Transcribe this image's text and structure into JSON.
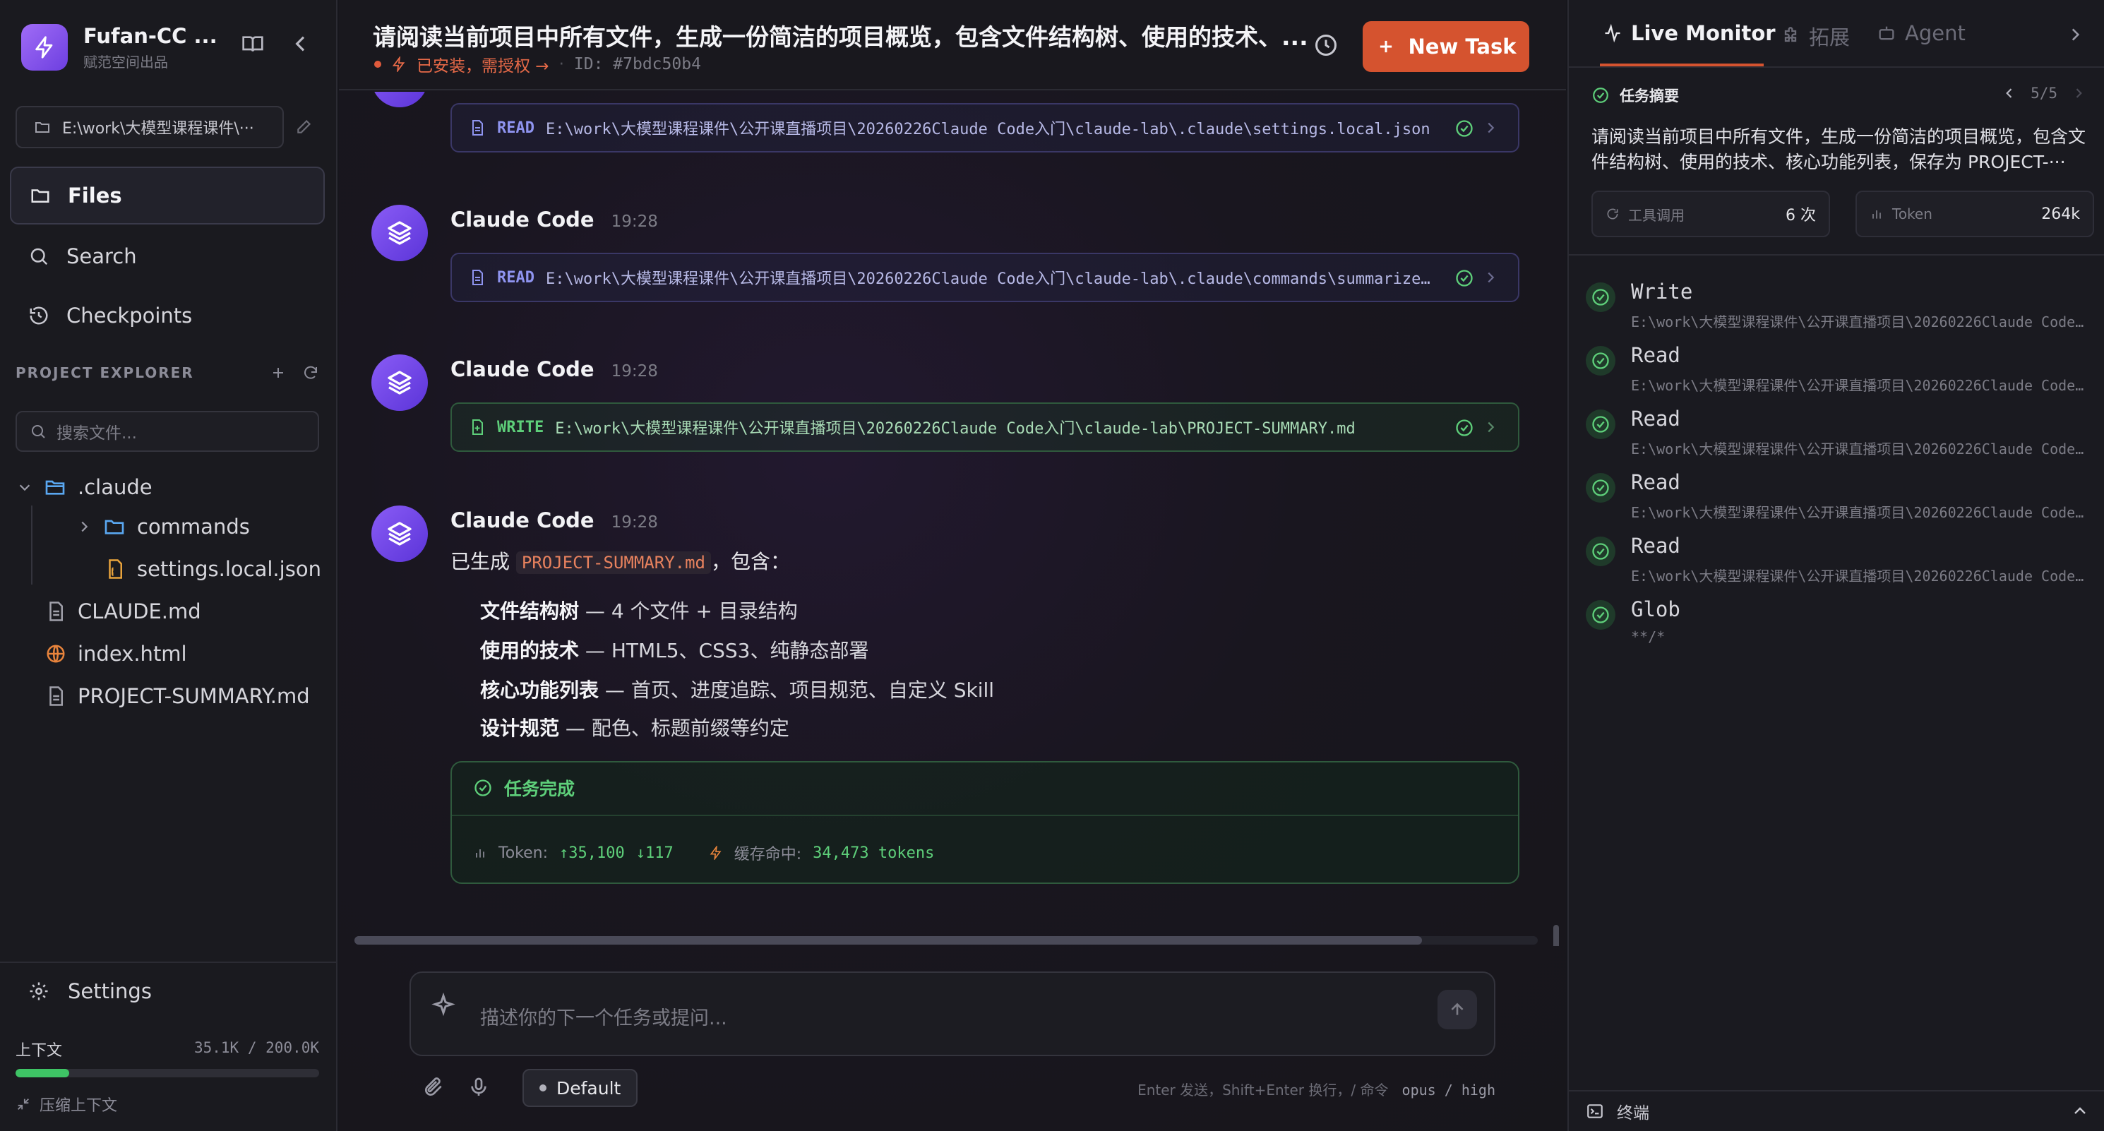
{
  "brand": {
    "name": "Fufan-CC ...",
    "subtitle": "赋范空间出品"
  },
  "sidebar": {
    "path": "E:\\work\\大模型课程课件\\···",
    "nav": [
      {
        "label": "Files",
        "icon": "folder-icon",
        "active": true
      },
      {
        "label": "Search",
        "icon": "search-icon",
        "active": false
      },
      {
        "label": "Checkpoints",
        "icon": "history-icon",
        "active": false
      }
    ],
    "explorer_title": "PROJECT EXPLORER",
    "search_placeholder": "搜索文件...",
    "tree": [
      {
        "label": ".claude",
        "type": "folder",
        "expanded": true
      },
      {
        "label": "commands",
        "type": "folder",
        "expanded": false
      },
      {
        "label": "settings.local.json",
        "type": "json"
      },
      {
        "label": "CLAUDE.md",
        "type": "file"
      },
      {
        "label": "index.html",
        "type": "html"
      },
      {
        "label": "PROJECT-SUMMARY.md",
        "type": "file"
      }
    ],
    "settings_label": "Settings",
    "context": {
      "label": "上下文",
      "value": "35.1K / 200.0K",
      "fraction": 0.176
    },
    "compress_label": "压缩上下文"
  },
  "task": {
    "title": "请阅读当前项目中所有文件，生成一份简洁的项目概览，包含文件结构树、使用的技术、...",
    "status": "已安装，需授权 →",
    "id": "ID: #7bdc50b4",
    "new_task_label": "New Task"
  },
  "messages": [
    {
      "tool": {
        "kind": "READ",
        "path": "E:\\work\\大模型课程课件\\公开课直播项目\\20260226Claude Code入门\\claude-lab\\.claude\\settings.local.json"
      }
    },
    {
      "author": "Claude Code",
      "time": "19:28",
      "tool": {
        "kind": "READ",
        "path": "E:\\work\\大模型课程课件\\公开课直播项目\\20260226Claude Code入门\\claude-lab\\.claude\\commands\\summarize..."
      }
    },
    {
      "author": "Claude Code",
      "time": "19:28",
      "tool": {
        "kind": "WRITE",
        "path": "E:\\work\\大模型课程课件\\公开课直播项目\\20260226Claude Code入门\\claude-lab\\PROJECT-SUMMARY.md"
      }
    },
    {
      "author": "Claude Code",
      "time": "19:28"
    }
  ],
  "final": {
    "intro_before": "已生成 ",
    "intro_code": "PROJECT-SUMMARY.md",
    "intro_after": "，包含：",
    "bullets": [
      {
        "bold": "文件结构树",
        "rest": " — 4 个文件 + 目录结构"
      },
      {
        "bold": "使用的技术",
        "rest": " — HTML5、CSS3、纯静态部署"
      },
      {
        "bold": "核心功能列表",
        "rest": " — 首页、进度追踪、项目规范、自定义 Skill"
      },
      {
        "bold": "设计规范",
        "rest": " — 配色、标题前缀等约定"
      }
    ],
    "done_label": "任务完成",
    "token_label": "Token:",
    "token_in": "↑35,100",
    "token_out": "↓117",
    "cache_label": "缓存命中:",
    "cache_value": "34,473 tokens"
  },
  "composer": {
    "placeholder": "描述你的下一个任务或提问...",
    "model_label": "Default",
    "hint": "Enter 发送，Shift+Enter 换行，/ 命令",
    "model_info": "opus / high"
  },
  "right": {
    "tabs": [
      {
        "label": "Live Monitor",
        "icon": "activity-icon",
        "active": true
      },
      {
        "label": "拓展",
        "icon": "puzzle-icon",
        "active": false
      },
      {
        "label": "Agent",
        "icon": "bot-icon",
        "active": false
      }
    ],
    "summary_title": "任务摘要",
    "pager": "5/5",
    "summary_text": "请阅读当前项目中所有文件，生成一份简洁的项目概览，包含文件结构树、使用的技术、核心功能列表，保存为 PROJECT-···",
    "tool_calls_label": "工具调用",
    "tool_calls_value": "6 次",
    "token_label": "Token",
    "token_value": "264k",
    "log": [
      {
        "title": "Write",
        "detail": "E:\\work\\大模型课程课件\\公开课直播项目\\20260226Claude Code..."
      },
      {
        "title": "Read",
        "detail": "E:\\work\\大模型课程课件\\公开课直播项目\\20260226Claude Code..."
      },
      {
        "title": "Read",
        "detail": "E:\\work\\大模型课程课件\\公开课直播项目\\20260226Claude Code..."
      },
      {
        "title": "Read",
        "detail": "E:\\work\\大模型课程课件\\公开课直播项目\\20260226Claude Code..."
      },
      {
        "title": "Read",
        "detail": "E:\\work\\大模型课程课件\\公开课直播项目\\20260226Claude Code..."
      },
      {
        "title": "Glob",
        "detail": "**/*"
      }
    ],
    "terminal_label": "终端"
  },
  "colors": {
    "accent": "#d5532f",
    "success": "#3ec465",
    "brand": "#7c4dff"
  }
}
